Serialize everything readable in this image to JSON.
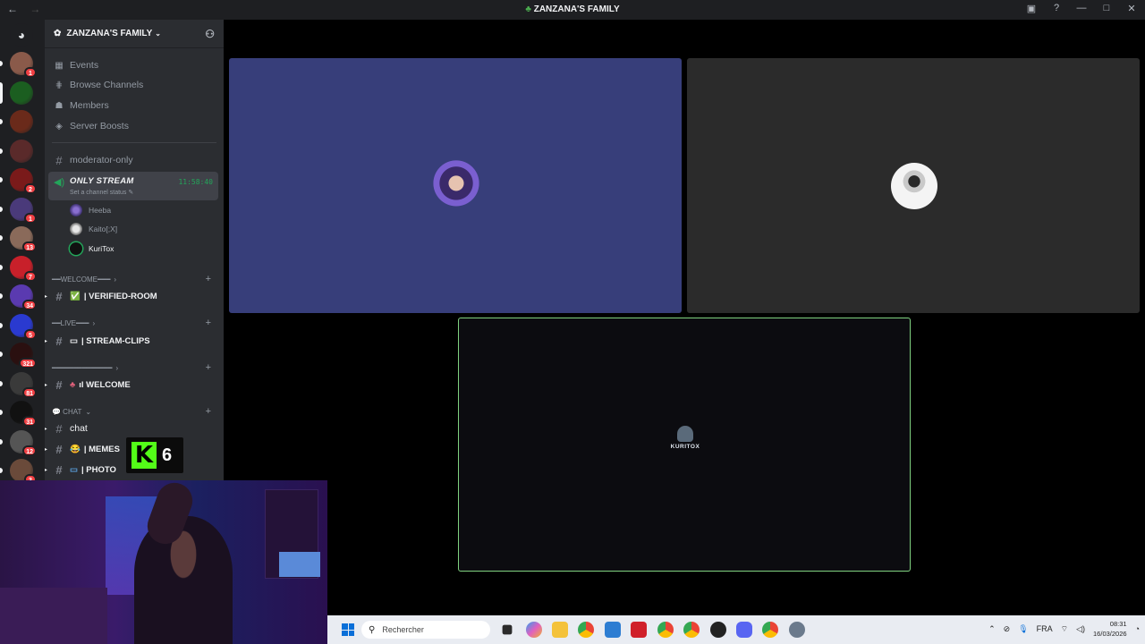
{
  "window": {
    "title": "ZANZANA'S FAMILY",
    "nav_back": "←",
    "nav_forward": "→"
  },
  "server": {
    "name": "ZANZANA'S FAMILY",
    "menu": [
      {
        "label": "Events",
        "icon": "calendar-icon"
      },
      {
        "label": "Browse Channels",
        "icon": "browse-icon"
      },
      {
        "label": "Members",
        "icon": "members-icon"
      },
      {
        "label": "Server Boosts",
        "icon": "boost-icon"
      }
    ]
  },
  "guild_badges": [
    "1",
    "",
    "",
    "",
    "2",
    "1",
    "13",
    "7",
    "34",
    "5",
    "321",
    "81",
    "31",
    "12",
    "3"
  ],
  "channels": {
    "moderator": "moderator-only",
    "stream": {
      "name": "ONLY STREAM",
      "status": "Set a channel status",
      "time": "11:58:40",
      "users": [
        "Heeba",
        "Kaito[;X]",
        "KuriTox"
      ]
    },
    "categories": [
      {
        "label": "━━WELCOME━━━",
        "channel": "| VERIFIED-ROOM",
        "emoji": "✅"
      },
      {
        "label": "━━LIVE━━━",
        "channel": "| STREAM-CLIPS",
        "emoji": "▭"
      },
      {
        "label": "━━━━━━━━━━━━━━",
        "channel": "ıl WELCOME",
        "emoji": "♣"
      },
      {
        "label": "💬 CHAT",
        "channel": "chat",
        "emoji": ""
      }
    ],
    "extra": [
      {
        "name": "| MEMES",
        "emoji": "😂"
      },
      {
        "name": "| PHOTO",
        "emoji": "▭"
      }
    ]
  },
  "stage": {
    "tile_logo_text": "KURITOX"
  },
  "overlay": {
    "kick_letter": "K",
    "kick_count": "6"
  },
  "taskbar": {
    "search_placeholder": "Rechercher",
    "lang": "FRA",
    "time": "08:31",
    "date": "16/03/2026"
  },
  "colors": {
    "tile_blue": "#373e7a",
    "tile_gray": "#2b2b2b",
    "tile_dark": "#0c0c10",
    "speaking_green": "#23a55a",
    "kick_green": "#53fc18"
  }
}
